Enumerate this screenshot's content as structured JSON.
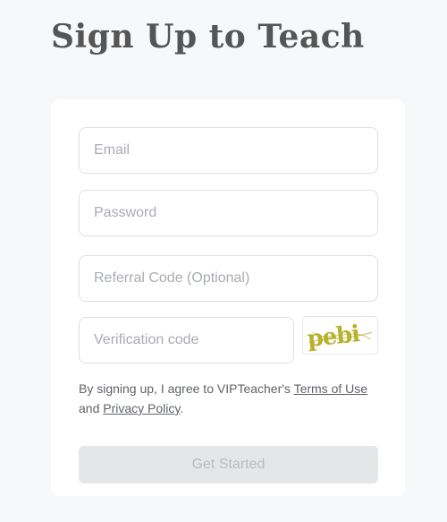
{
  "page": {
    "title": "Sign Up to Teach"
  },
  "form": {
    "email": {
      "placeholder": "Email",
      "value": ""
    },
    "password": {
      "placeholder": "Password",
      "value": ""
    },
    "referral": {
      "placeholder": "Referral Code (Optional)",
      "value": ""
    },
    "verification": {
      "placeholder": "Verification code",
      "value": ""
    },
    "captcha": {
      "text": "pebi",
      "icon": "captcha-image"
    }
  },
  "agreement": {
    "prefix": "By signing up, I agree to VIPTeacher's",
    "terms_link": "Terms of Use",
    "conjunction": "and",
    "privacy_link": "Privacy Policy",
    "suffix": "."
  },
  "submit": {
    "label": "Get Started",
    "disabled": true
  },
  "colors": {
    "background": "#f7f8fa",
    "card": "#ffffff",
    "border": "#dcdfe6",
    "placeholder": "#a8abb2",
    "button_disabled_bg": "#e5e6e8",
    "button_disabled_text": "#b9bcc0",
    "captcha_text": "#b6b22c"
  }
}
